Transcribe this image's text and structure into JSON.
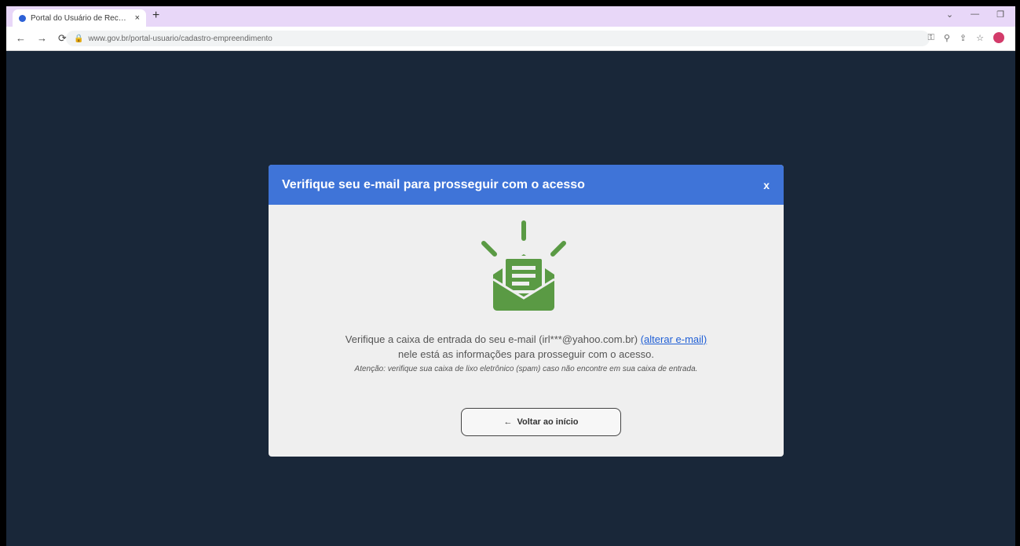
{
  "browser": {
    "tab_title": "Portal do Usuário de Recursos Hídricos",
    "tab_close": "×",
    "new_tab": "+",
    "url": "www.gov.br/portal-usuario/cadastro-empreendimento",
    "window_controls": [
      "⌄",
      "—",
      "❐"
    ]
  },
  "modal": {
    "title": "Verifique seu e-mail para prosseguir com o acesso",
    "close": "x",
    "message_prefix": "Verifique a caixa de entrada do seu e-mail (irl***@yahoo.com.br) ",
    "change_email_link": "(alterar e-mail)",
    "message_line2": "nele está as informações para prosseguir com o acesso.",
    "note": "Atenção: verifique sua caixa de lixo eletrônico (spam) caso não encontre em sua caixa de entrada.",
    "back_button_arrow": "←",
    "back_button_label": "Voltar ao início"
  },
  "colors": {
    "background": "#192739",
    "header": "#3f74d8",
    "icon_green": "#5a9a44",
    "link": "#2160d6"
  },
  "icons": {
    "tab_favicon": "favicon-icon",
    "email": "open-envelope-icon",
    "back": "arrow-left-icon"
  }
}
